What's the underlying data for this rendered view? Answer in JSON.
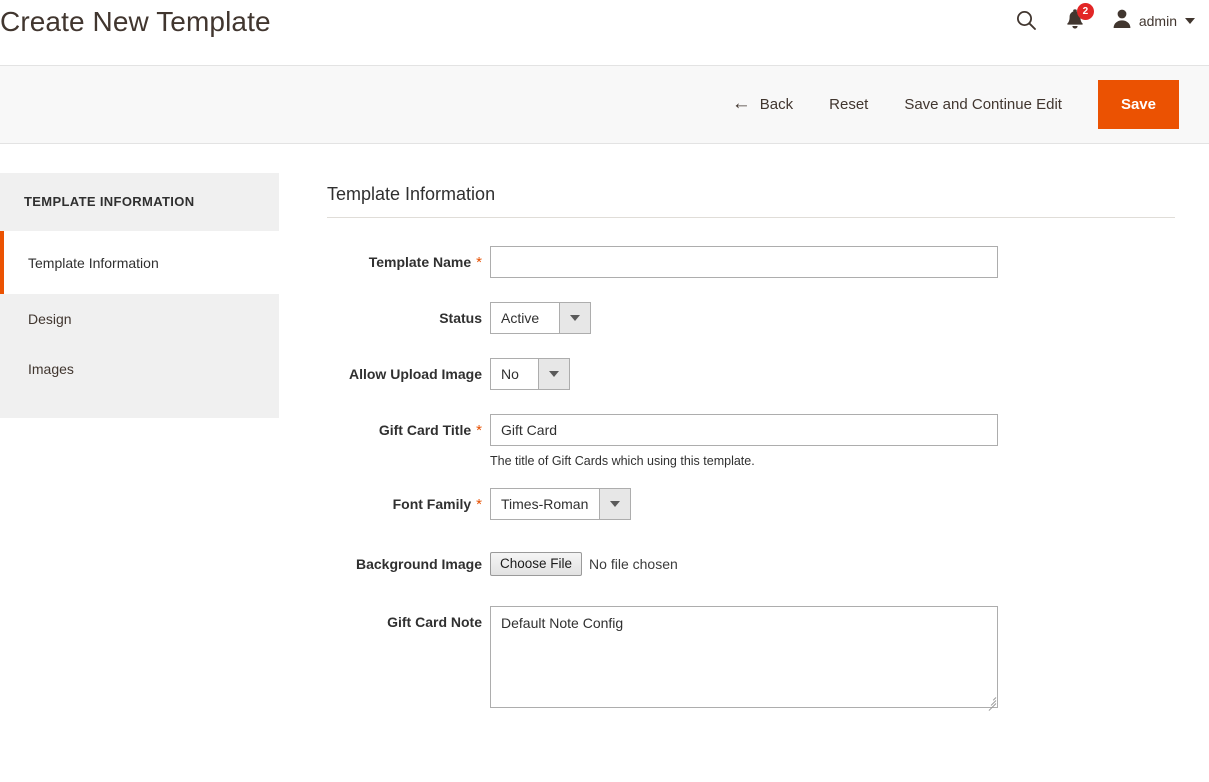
{
  "header": {
    "title": "Create New Template",
    "search_icon": "search-icon",
    "notifications_icon": "bell-icon",
    "notifications_count": "2",
    "user_icon": "user-icon",
    "user_name": "admin"
  },
  "page_actions": {
    "back_label": "Back",
    "back_icon": "arrow-left-icon",
    "reset_label": "Reset",
    "save_continue_label": "Save and Continue Edit",
    "save_label": "Save",
    "save_color": "#eb5202"
  },
  "sidebar": {
    "heading": "TEMPLATE INFORMATION",
    "items": [
      {
        "label": "Template Information",
        "active": true
      },
      {
        "label": "Design",
        "active": false
      },
      {
        "label": "Images",
        "active": false
      }
    ],
    "active_accent_color": "#eb5202"
  },
  "form": {
    "section_title": "Template Information",
    "required_marker": "*",
    "fields": {
      "template_name": {
        "label": "Template Name",
        "value": "",
        "placeholder": ""
      },
      "status": {
        "label": "Status",
        "value": "Active"
      },
      "allow_upload_image": {
        "label": "Allow Upload Image",
        "value": "No"
      },
      "gift_card_title": {
        "label": "Gift Card Title",
        "value": "Gift Card",
        "note": "The title of Gift Cards which using this template."
      },
      "font_family": {
        "label": "Font Family",
        "value": "Times-Roman"
      },
      "background_image": {
        "label": "Background Image",
        "button_label": "Choose File",
        "status_text": "No file chosen"
      },
      "gift_card_note": {
        "label": "Gift Card Note",
        "value": "Default Note Config"
      }
    }
  }
}
